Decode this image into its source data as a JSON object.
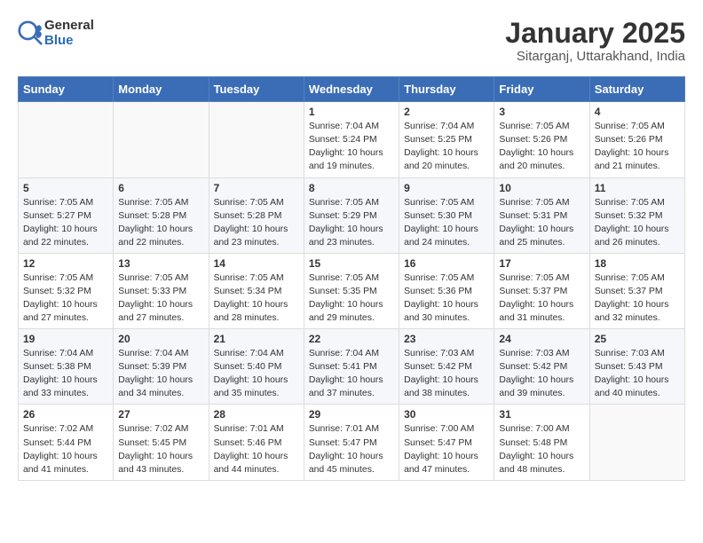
{
  "header": {
    "logo_general": "General",
    "logo_blue": "Blue",
    "month_title": "January 2025",
    "location": "Sitarganj, Uttarakhand, India"
  },
  "weekdays": [
    "Sunday",
    "Monday",
    "Tuesday",
    "Wednesday",
    "Thursday",
    "Friday",
    "Saturday"
  ],
  "weeks": [
    [
      {
        "day": "",
        "info": ""
      },
      {
        "day": "",
        "info": ""
      },
      {
        "day": "",
        "info": ""
      },
      {
        "day": "1",
        "info": "Sunrise: 7:04 AM\nSunset: 5:24 PM\nDaylight: 10 hours\nand 19 minutes."
      },
      {
        "day": "2",
        "info": "Sunrise: 7:04 AM\nSunset: 5:25 PM\nDaylight: 10 hours\nand 20 minutes."
      },
      {
        "day": "3",
        "info": "Sunrise: 7:05 AM\nSunset: 5:26 PM\nDaylight: 10 hours\nand 20 minutes."
      },
      {
        "day": "4",
        "info": "Sunrise: 7:05 AM\nSunset: 5:26 PM\nDaylight: 10 hours\nand 21 minutes."
      }
    ],
    [
      {
        "day": "5",
        "info": "Sunrise: 7:05 AM\nSunset: 5:27 PM\nDaylight: 10 hours\nand 22 minutes."
      },
      {
        "day": "6",
        "info": "Sunrise: 7:05 AM\nSunset: 5:28 PM\nDaylight: 10 hours\nand 22 minutes."
      },
      {
        "day": "7",
        "info": "Sunrise: 7:05 AM\nSunset: 5:28 PM\nDaylight: 10 hours\nand 23 minutes."
      },
      {
        "day": "8",
        "info": "Sunrise: 7:05 AM\nSunset: 5:29 PM\nDaylight: 10 hours\nand 23 minutes."
      },
      {
        "day": "9",
        "info": "Sunrise: 7:05 AM\nSunset: 5:30 PM\nDaylight: 10 hours\nand 24 minutes."
      },
      {
        "day": "10",
        "info": "Sunrise: 7:05 AM\nSunset: 5:31 PM\nDaylight: 10 hours\nand 25 minutes."
      },
      {
        "day": "11",
        "info": "Sunrise: 7:05 AM\nSunset: 5:32 PM\nDaylight: 10 hours\nand 26 minutes."
      }
    ],
    [
      {
        "day": "12",
        "info": "Sunrise: 7:05 AM\nSunset: 5:32 PM\nDaylight: 10 hours\nand 27 minutes."
      },
      {
        "day": "13",
        "info": "Sunrise: 7:05 AM\nSunset: 5:33 PM\nDaylight: 10 hours\nand 27 minutes."
      },
      {
        "day": "14",
        "info": "Sunrise: 7:05 AM\nSunset: 5:34 PM\nDaylight: 10 hours\nand 28 minutes."
      },
      {
        "day": "15",
        "info": "Sunrise: 7:05 AM\nSunset: 5:35 PM\nDaylight: 10 hours\nand 29 minutes."
      },
      {
        "day": "16",
        "info": "Sunrise: 7:05 AM\nSunset: 5:36 PM\nDaylight: 10 hours\nand 30 minutes."
      },
      {
        "day": "17",
        "info": "Sunrise: 7:05 AM\nSunset: 5:37 PM\nDaylight: 10 hours\nand 31 minutes."
      },
      {
        "day": "18",
        "info": "Sunrise: 7:05 AM\nSunset: 5:37 PM\nDaylight: 10 hours\nand 32 minutes."
      }
    ],
    [
      {
        "day": "19",
        "info": "Sunrise: 7:04 AM\nSunset: 5:38 PM\nDaylight: 10 hours\nand 33 minutes."
      },
      {
        "day": "20",
        "info": "Sunrise: 7:04 AM\nSunset: 5:39 PM\nDaylight: 10 hours\nand 34 minutes."
      },
      {
        "day": "21",
        "info": "Sunrise: 7:04 AM\nSunset: 5:40 PM\nDaylight: 10 hours\nand 35 minutes."
      },
      {
        "day": "22",
        "info": "Sunrise: 7:04 AM\nSunset: 5:41 PM\nDaylight: 10 hours\nand 37 minutes."
      },
      {
        "day": "23",
        "info": "Sunrise: 7:03 AM\nSunset: 5:42 PM\nDaylight: 10 hours\nand 38 minutes."
      },
      {
        "day": "24",
        "info": "Sunrise: 7:03 AM\nSunset: 5:42 PM\nDaylight: 10 hours\nand 39 minutes."
      },
      {
        "day": "25",
        "info": "Sunrise: 7:03 AM\nSunset: 5:43 PM\nDaylight: 10 hours\nand 40 minutes."
      }
    ],
    [
      {
        "day": "26",
        "info": "Sunrise: 7:02 AM\nSunset: 5:44 PM\nDaylight: 10 hours\nand 41 minutes."
      },
      {
        "day": "27",
        "info": "Sunrise: 7:02 AM\nSunset: 5:45 PM\nDaylight: 10 hours\nand 43 minutes."
      },
      {
        "day": "28",
        "info": "Sunrise: 7:01 AM\nSunset: 5:46 PM\nDaylight: 10 hours\nand 44 minutes."
      },
      {
        "day": "29",
        "info": "Sunrise: 7:01 AM\nSunset: 5:47 PM\nDaylight: 10 hours\nand 45 minutes."
      },
      {
        "day": "30",
        "info": "Sunrise: 7:00 AM\nSunset: 5:47 PM\nDaylight: 10 hours\nand 47 minutes."
      },
      {
        "day": "31",
        "info": "Sunrise: 7:00 AM\nSunset: 5:48 PM\nDaylight: 10 hours\nand 48 minutes."
      },
      {
        "day": "",
        "info": ""
      }
    ]
  ]
}
